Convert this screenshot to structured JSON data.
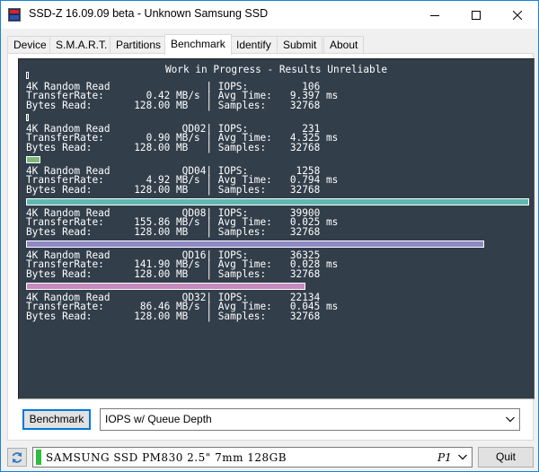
{
  "window": {
    "title": "SSD-Z 16.09.09 beta - Unknown Samsung SSD"
  },
  "tabs": [
    {
      "label": "Device"
    },
    {
      "label": "S.M.A.R.T."
    },
    {
      "label": "Partitions"
    },
    {
      "label": "Benchmark",
      "active": true
    },
    {
      "label": "Identify"
    },
    {
      "label": "Submit"
    },
    {
      "label": "About"
    }
  ],
  "benchmark": {
    "header": "Work in Progress - Results Unreliable",
    "results": [
      {
        "line1": "4K Random Read                | IOPS:         106",
        "line2": "TransferRate:       0.42 MB/s | Avg Time:   9.397 ms",
        "line3": "Bytes Read:       128.00 MB   | Samples:    32768",
        "bar_fraction": 0.003,
        "bar_color": "#323e4a"
      },
      {
        "line1": "4K Random Read            QD02| IOPS:         231",
        "line2": "TransferRate:       0.90 MB/s | Avg Time:   4.325 ms",
        "line3": "Bytes Read:       128.00 MB   | Samples:    32768",
        "bar_fraction": 0.003,
        "bar_color": "#5e8a4a"
      },
      {
        "line1": "4K Random Read            QD04| IOPS:        1258",
        "line2": "TransferRate:       4.92 MB/s | Avg Time:   0.794 ms",
        "line3": "Bytes Read:       128.00 MB   | Samples:    32768",
        "bar_fraction": 0.029,
        "bar_color": "#7dba7d"
      },
      {
        "line1": "4K Random Read            QD08| IOPS:       39900",
        "line2": "TransferRate:     155.86 MB/s | Avg Time:   0.025 ms",
        "line3": "Bytes Read:       128.00 MB   | Samples:    32768",
        "bar_fraction": 1.0,
        "bar_color": "#5fb8b0"
      },
      {
        "line1": "4K Random Read            QD16| IOPS:       36325",
        "line2": "TransferRate:     141.90 MB/s | Avg Time:   0.028 ms",
        "line3": "Bytes Read:       128.00 MB   | Samples:    32768",
        "bar_fraction": 0.91,
        "bar_color": "#8e88c6"
      },
      {
        "line1": "4K Random Read            QD32| IOPS:       22134",
        "line2": "TransferRate:      86.46 MB/s | Avg Time:   0.045 ms",
        "line3": "Bytes Read:       128.00 MB   | Samples:    32768",
        "bar_fraction": 0.555,
        "bar_color": "#c58bbf"
      }
    ],
    "button_label": "Benchmark",
    "mode": "IOPS w/ Queue Depth"
  },
  "footer": {
    "drive_name": "SAMSUNG SSD PM830 2.5\" 7mm 128GB",
    "drive_port": "P1",
    "quit_label": "Quit"
  }
}
